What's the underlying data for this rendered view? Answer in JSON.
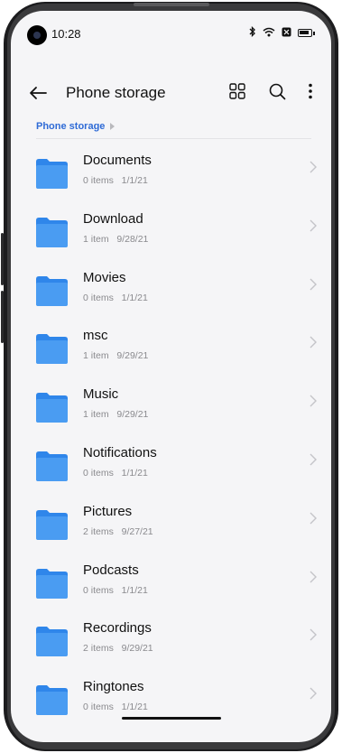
{
  "status_bar": {
    "time": "10:28"
  },
  "toolbar": {
    "title": "Phone storage"
  },
  "breadcrumb": {
    "label": "Phone storage"
  },
  "folders": [
    {
      "name": "Documents",
      "count": "0 items",
      "date": "1/1/21"
    },
    {
      "name": "Download",
      "count": "1 item",
      "date": "9/28/21"
    },
    {
      "name": "Movies",
      "count": "0 items",
      "date": "1/1/21"
    },
    {
      "name": "msc",
      "count": "1 item",
      "date": "9/29/21"
    },
    {
      "name": "Music",
      "count": "1 item",
      "date": "9/29/21"
    },
    {
      "name": "Notifications",
      "count": "0 items",
      "date": "1/1/21"
    },
    {
      "name": "Pictures",
      "count": "2 items",
      "date": "9/27/21"
    },
    {
      "name": "Podcasts",
      "count": "0 items",
      "date": "1/1/21"
    },
    {
      "name": "Recordings",
      "count": "2 items",
      "date": "9/29/21"
    },
    {
      "name": "Ringtones",
      "count": "0 items",
      "date": "1/1/21"
    }
  ],
  "colors": {
    "accent": "#2f6bd6",
    "folder": "#4a9cf2",
    "folder_tab": "#2f86ea"
  },
  "icons": [
    "back-arrow-icon",
    "grid-view-icon",
    "search-icon",
    "more-options-icon",
    "folder-icon",
    "chevron-right-icon",
    "bluetooth-icon",
    "wifi-icon",
    "battery-icon"
  ]
}
